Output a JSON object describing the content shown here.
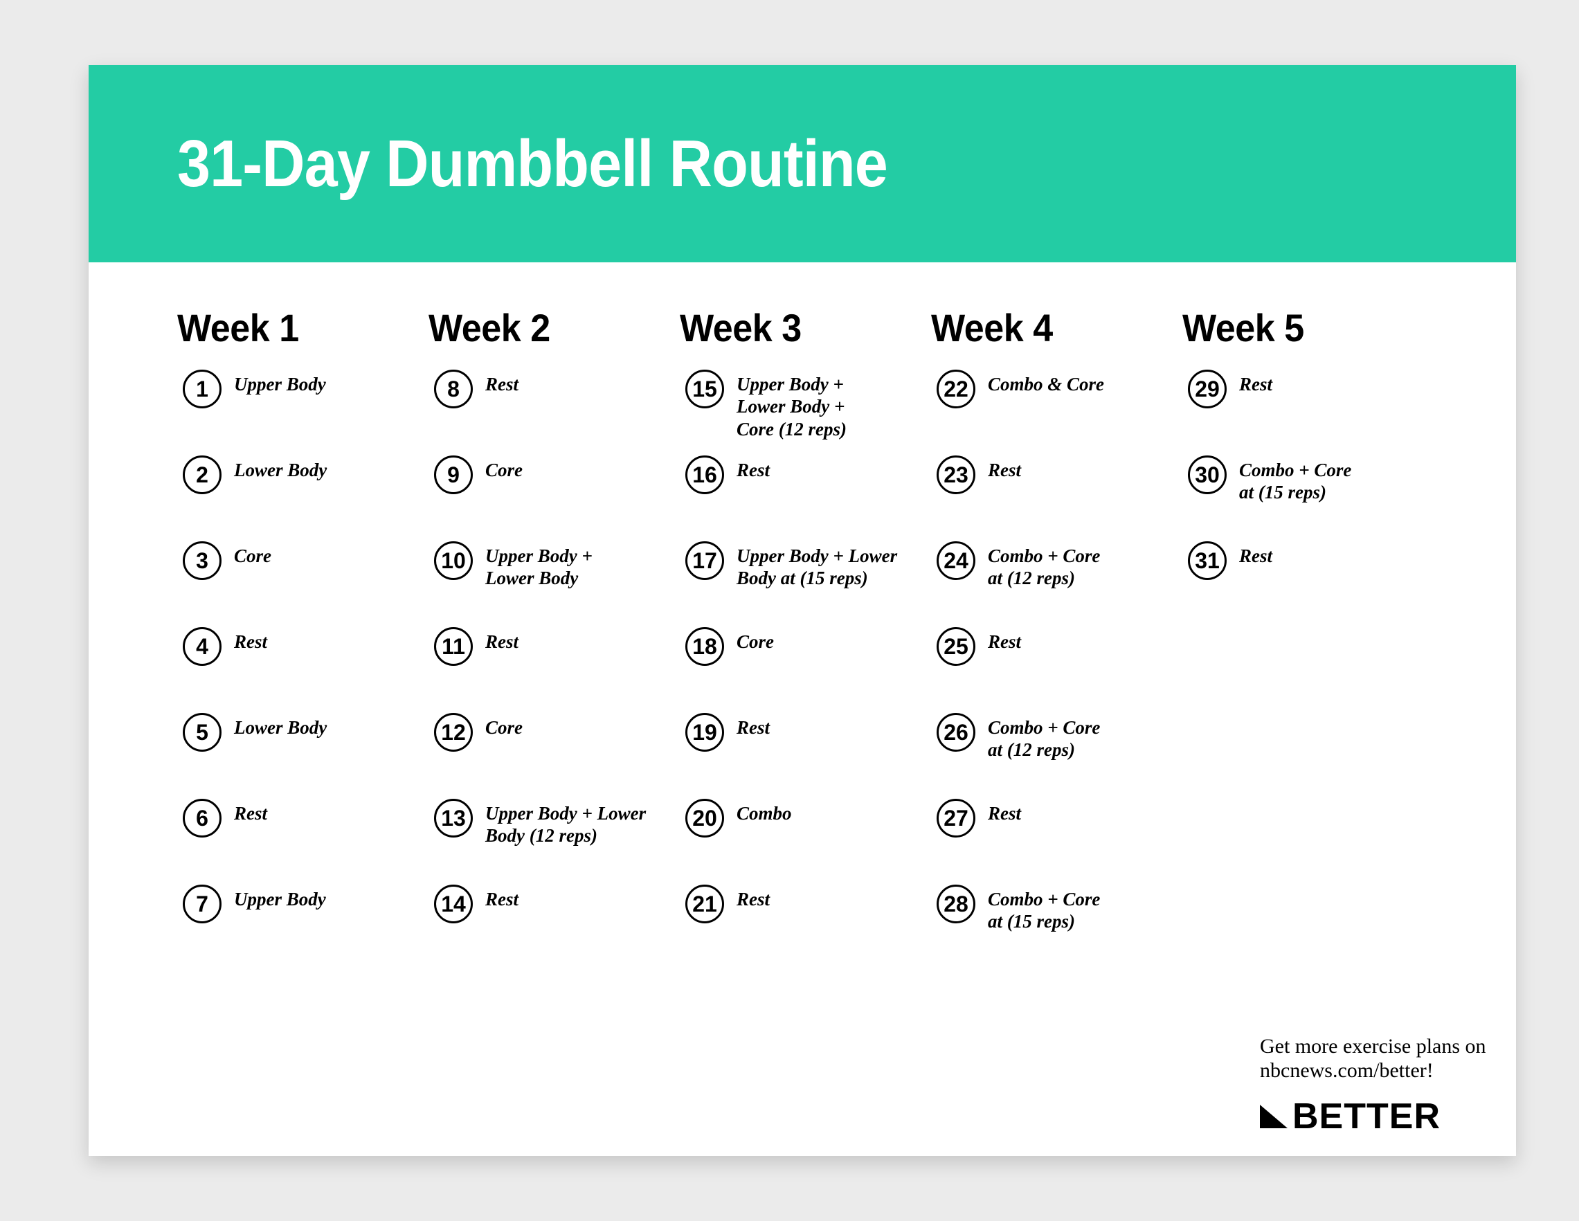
{
  "header": {
    "title": "31-Day Dumbbell Routine",
    "band_color": "#23cca4",
    "title_color": "#ffffff"
  },
  "page": {
    "background_color": "#ebebeb",
    "card_color": "#ffffff"
  },
  "weeks": [
    {
      "title": "Week 1",
      "days": [
        {
          "number": "1",
          "label": "Upper Body"
        },
        {
          "number": "2",
          "label": "Lower Body"
        },
        {
          "number": "3",
          "label": "Core"
        },
        {
          "number": "4",
          "label": "Rest"
        },
        {
          "number": "5",
          "label": "Lower Body"
        },
        {
          "number": "6",
          "label": "Rest"
        },
        {
          "number": "7",
          "label": "Upper Body"
        }
      ]
    },
    {
      "title": "Week 2",
      "days": [
        {
          "number": "8",
          "label": "Rest"
        },
        {
          "number": "9",
          "label": "Core"
        },
        {
          "number": "10",
          "label": "Upper Body +\nLower Body"
        },
        {
          "number": "11",
          "label": "Rest"
        },
        {
          "number": "12",
          "label": "Core"
        },
        {
          "number": "13",
          "label": "Upper Body + Lower\nBody (12 reps)"
        },
        {
          "number": "14",
          "label": "Rest"
        }
      ]
    },
    {
      "title": "Week 3",
      "days": [
        {
          "number": "15",
          "label": "Upper Body +\nLower Body +\nCore (12 reps)"
        },
        {
          "number": "16",
          "label": "Rest"
        },
        {
          "number": "17",
          "label": "Upper Body + Lower\nBody at (15 reps)"
        },
        {
          "number": "18",
          "label": "Core"
        },
        {
          "number": "19",
          "label": "Rest"
        },
        {
          "number": "20",
          "label": "Combo"
        },
        {
          "number": "21",
          "label": "Rest"
        }
      ]
    },
    {
      "title": "Week 4",
      "days": [
        {
          "number": "22",
          "label": "Combo & Core"
        },
        {
          "number": "23",
          "label": "Rest"
        },
        {
          "number": "24",
          "label": "Combo + Core\nat (12 reps)"
        },
        {
          "number": "25",
          "label": "Rest"
        },
        {
          "number": "26",
          "label": "Combo + Core\nat (12 reps)"
        },
        {
          "number": "27",
          "label": "Rest"
        },
        {
          "number": "28",
          "label": "Combo + Core\nat (15 reps)"
        }
      ]
    },
    {
      "title": "Week 5",
      "days": [
        {
          "number": "29",
          "label": "Rest"
        },
        {
          "number": "30",
          "label": "Combo + Core\nat (15 reps)"
        },
        {
          "number": "31",
          "label": "Rest"
        }
      ]
    }
  ],
  "footer": {
    "promo_text": "Get more exercise plans on\nnbcnews.com/better!",
    "brand_name": "BETTER",
    "brand_mark": "triangle-logo-mark"
  }
}
